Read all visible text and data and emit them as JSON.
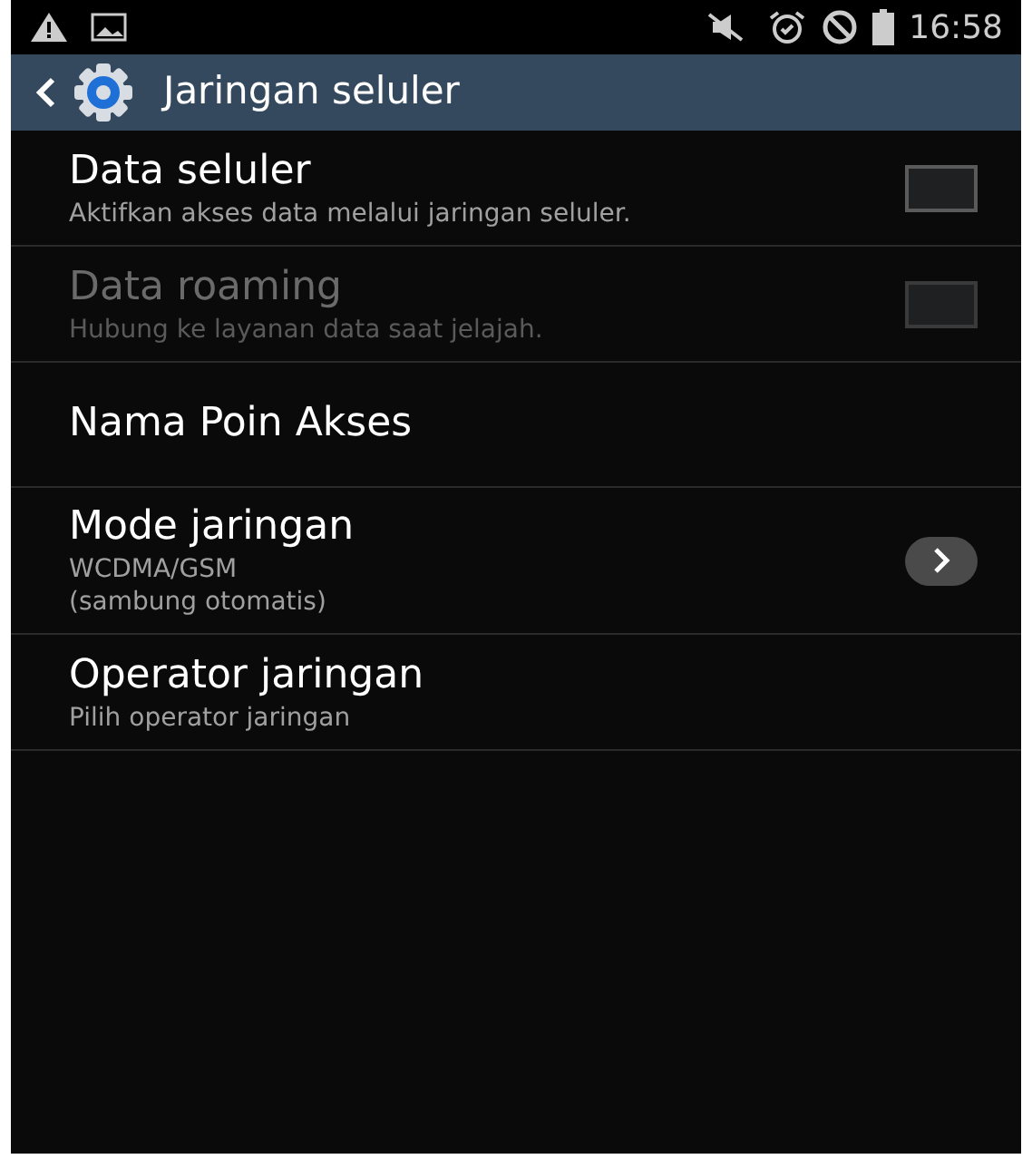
{
  "status_bar": {
    "time": "16:58"
  },
  "action_bar": {
    "title": "Jaringan seluler"
  },
  "settings": [
    {
      "kind": "checkbox",
      "title": "Data seluler",
      "summary": "Aktifkan akses data melalui jaringan seluler.",
      "checked": false,
      "disabled": false
    },
    {
      "kind": "checkbox",
      "title": "Data roaming",
      "summary": "Hubung ke layanan data saat jelajah.",
      "checked": false,
      "disabled": true
    },
    {
      "kind": "plain",
      "title": "Nama Poin Akses",
      "disabled": false
    },
    {
      "kind": "arrow",
      "title": "Mode jaringan",
      "summary": "WCDMA/GSM\n(sambung otomatis)",
      "disabled": false
    },
    {
      "kind": "plain",
      "title": "Operator jaringan",
      "summary": "Pilih operator jaringan",
      "disabled": false
    }
  ]
}
